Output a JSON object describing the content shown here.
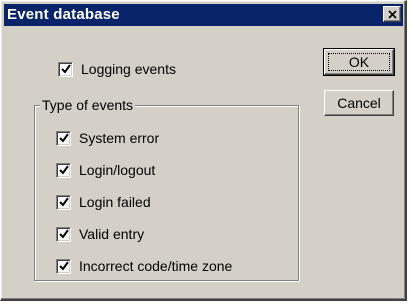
{
  "window": {
    "title": "Event database",
    "close_glyph": "✕"
  },
  "logging": {
    "label": "Logging events",
    "checked": true
  },
  "group": {
    "label": "Type of events",
    "items": [
      {
        "label": "System error",
        "checked": true
      },
      {
        "label": "Login/logout",
        "checked": true
      },
      {
        "label": "Login failed",
        "checked": true
      },
      {
        "label": "Valid entry",
        "checked": true
      },
      {
        "label": "Incorrect code/time zone",
        "checked": true
      }
    ]
  },
  "buttons": {
    "ok_label": "OK",
    "cancel_label": "Cancel"
  },
  "icons": {
    "checkbox": "check-icon",
    "close": "close-icon"
  }
}
